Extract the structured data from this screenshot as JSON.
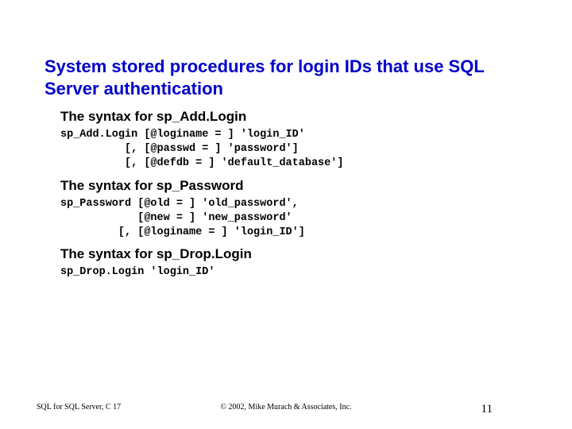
{
  "title": "System stored procedures for login IDs that use SQL Server authentication",
  "sections": [
    {
      "heading": "The syntax for sp_Add.Login",
      "code": "sp_Add.Login [@loginame = ] 'login_ID'\n          [, [@passwd = ] 'password']\n          [, [@defdb = ] 'default_database']"
    },
    {
      "heading": "The syntax for sp_Password",
      "code": "sp_Password [@old = ] 'old_password',\n            [@new = ] 'new_password'\n         [, [@loginame = ] 'login_ID']"
    },
    {
      "heading": "The syntax for sp_Drop.Login",
      "code": "sp_Drop.Login 'login_ID'"
    }
  ],
  "footer": {
    "left": "SQL for SQL Server, C 17",
    "center": "© 2002, Mike Murach & Associates, Inc.",
    "right": "11"
  }
}
